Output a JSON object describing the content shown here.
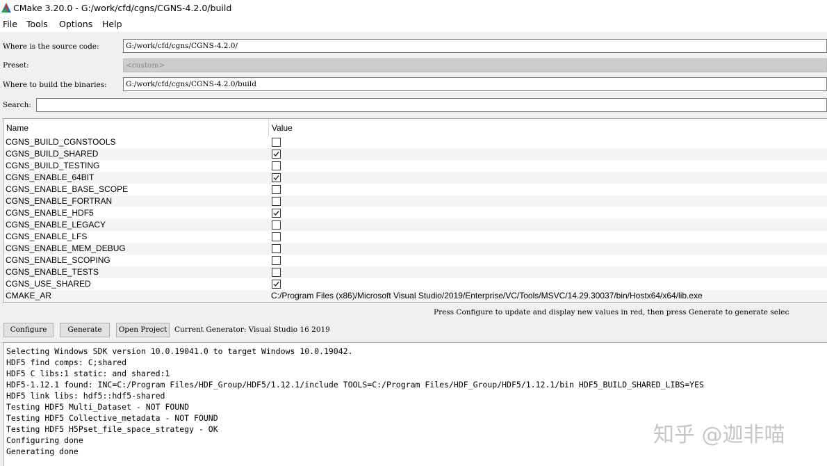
{
  "window": {
    "title": "CMake 3.20.0 - G:/work/cfd/cgns/CGNS-4.2.0/build",
    "icon": "cmake-triangle-icon"
  },
  "menu": [
    "File",
    "Tools",
    "Options",
    "Help"
  ],
  "form": {
    "source_label": "Where is the source code:",
    "source_value": "G:/work/cfd/cgns/CGNS-4.2.0/",
    "preset_label": "Preset:",
    "preset_value": "<custom>",
    "binaries_label": "Where to build the binaries:",
    "binaries_value": "G:/work/cfd/cgns/CGNS-4.2.0/build",
    "search_label": "Search:",
    "search_value": ""
  },
  "table": {
    "headers": {
      "name": "Name",
      "value": "Value"
    },
    "rows": [
      {
        "name": "CGNS_BUILD_CGNSTOOLS",
        "checked": false
      },
      {
        "name": "CGNS_BUILD_SHARED",
        "checked": true
      },
      {
        "name": "CGNS_BUILD_TESTING",
        "checked": false
      },
      {
        "name": "CGNS_ENABLE_64BIT",
        "checked": true
      },
      {
        "name": "CGNS_ENABLE_BASE_SCOPE",
        "checked": false
      },
      {
        "name": "CGNS_ENABLE_FORTRAN",
        "checked": false
      },
      {
        "name": "CGNS_ENABLE_HDF5",
        "checked": true
      },
      {
        "name": "CGNS_ENABLE_LEGACY",
        "checked": false
      },
      {
        "name": "CGNS_ENABLE_LFS",
        "checked": false
      },
      {
        "name": "CGNS_ENABLE_MEM_DEBUG",
        "checked": false
      },
      {
        "name": "CGNS_ENABLE_SCOPING",
        "checked": false
      },
      {
        "name": "CGNS_ENABLE_TESTS",
        "checked": false
      },
      {
        "name": "CGNS_USE_SHARED",
        "checked": true
      },
      {
        "name": "CMAKE_AR",
        "text": "C:/Program Files (x86)/Microsoft Visual Studio/2019/Enterprise/VC/Tools/MSVC/14.29.30037/bin/Hostx64/x64/lib.exe"
      }
    ]
  },
  "hint": "Press Configure to update and display new values in red,  then press Generate to generate selec",
  "buttons": {
    "configure": "Configure",
    "generate": "Generate",
    "open_project": "Open Project"
  },
  "generator_label": "Current Generator: Visual Studio 16 2019",
  "output": [
    "Selecting Windows SDK version 10.0.19041.0 to target Windows 10.0.19042.",
    "HDF5 find comps: C;shared",
    "HDF5 C libs:1 static: and shared:1",
    "HDF5-1.12.1 found: INC=C:/Program Files/HDF_Group/HDF5/1.12.1/include TOOLS=C:/Program Files/HDF_Group/HDF5/1.12.1/bin HDF5_BUILD_SHARED_LIBS=YES",
    "HDF5 link libs: hdf5::hdf5-shared",
    "Testing HDF5 Multi_Dataset - NOT FOUND",
    "Testing HDF5 Collective_metadata - NOT FOUND",
    "Testing HDF5 H5Pset_file_space_strategy - OK",
    "Configuring done",
    "Generating done"
  ],
  "watermark": "知乎 @迦非喵"
}
